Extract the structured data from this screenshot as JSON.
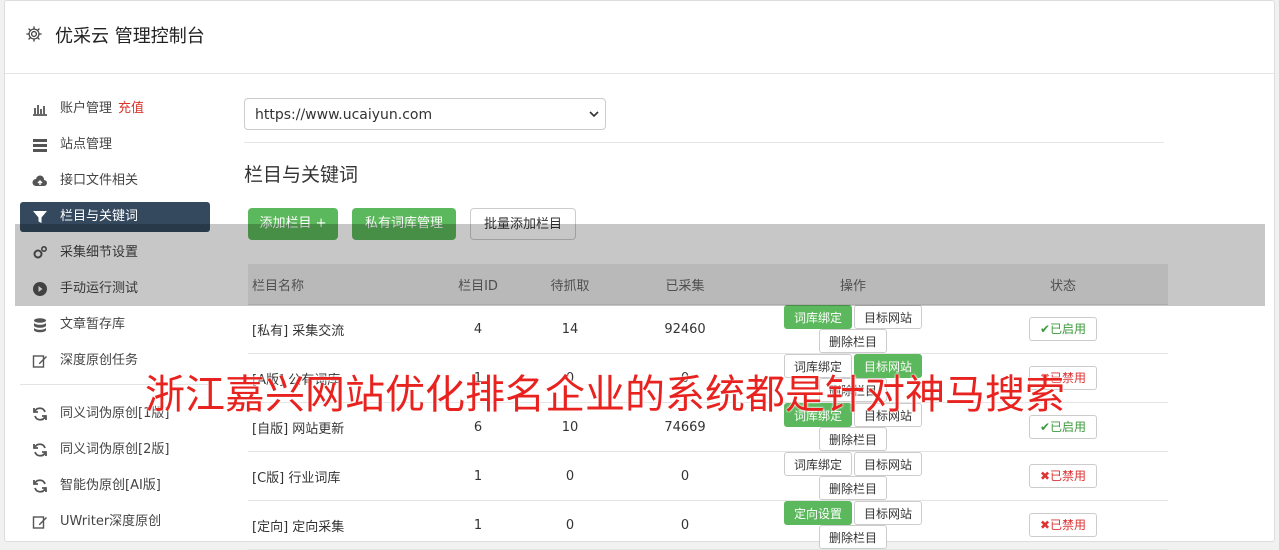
{
  "header": {
    "title": "优采云 管理控制台",
    "icon": "gear-icon"
  },
  "sidebar": {
    "items": [
      {
        "label": "账户管理",
        "extra": "充值",
        "icon": "bar-chart-icon"
      },
      {
        "label": "站点管理",
        "icon": "server-icon"
      },
      {
        "label": "接口文件相关",
        "icon": "cloud-upload-icon"
      },
      {
        "label": "栏目与关键词",
        "icon": "filter-icon",
        "active": true
      },
      {
        "label": "采集细节设置",
        "icon": "cogs-icon"
      },
      {
        "label": "手动运行测试",
        "icon": "play-circle-icon"
      },
      {
        "label": "文章暂存库",
        "icon": "database-icon"
      },
      {
        "label": "深度原创任务",
        "icon": "edit-icon"
      },
      {
        "label": "同义词伪原创[1版]",
        "icon": "refresh-icon"
      },
      {
        "label": "同义词伪原创[2版]",
        "icon": "refresh-icon"
      },
      {
        "label": "智能伪原创[AI版]",
        "icon": "refresh-icon"
      },
      {
        "label": "UWriter深度原创",
        "icon": "edit-icon"
      }
    ]
  },
  "site_select": {
    "value": "https://www.ucaiyun.com"
  },
  "section": {
    "title": "栏目与关键词"
  },
  "toolbar": {
    "add_column": "添加栏目 +",
    "private_lib": "私有词库管理",
    "batch_add": "批量添加栏目"
  },
  "table": {
    "headers": [
      "栏目名称",
      "栏目ID",
      "待抓取",
      "已采集",
      "操作",
      "状态"
    ],
    "rows": [
      {
        "tag": "[私有]",
        "name": "采集交流",
        "id": "4",
        "pending": "14",
        "collected": "92460",
        "op1": "词库绑定",
        "op2": "目标网站",
        "op3": "删除栏目",
        "status": "已启用"
      },
      {
        "tag": "[A版]",
        "name": "公有词库",
        "id": "1",
        "pending": "0",
        "collected": "0",
        "op1": "词库绑定",
        "op2": "目标网站",
        "op3": "删除栏目",
        "status": "已禁用"
      },
      {
        "tag": "[自版]",
        "name": "网站更新",
        "id": "6",
        "pending": "10",
        "collected": "74669",
        "op1": "词库绑定",
        "op2": "目标网站",
        "op3": "删除栏目",
        "status": "已启用"
      },
      {
        "tag": "[C版]",
        "name": "行业词库",
        "id": "1",
        "pending": "0",
        "collected": "0",
        "op1": "词库绑定",
        "op2": "目标网站",
        "op3": "删除栏目",
        "status": "已禁用"
      },
      {
        "tag": "[定向]",
        "name": "定向采集",
        "id": "1",
        "pending": "0",
        "collected": "0",
        "op1": "定向设置",
        "op2": "目标网站",
        "op3": "删除栏目",
        "status": "已禁用"
      }
    ]
  },
  "watermark": {
    "text": "浙江嘉兴网站优化排名企业的系统都是针对神马搜索"
  },
  "colors": {
    "accent_green": "#5cb85c",
    "active_nav": "#34495e",
    "danger": "#d9342b"
  }
}
